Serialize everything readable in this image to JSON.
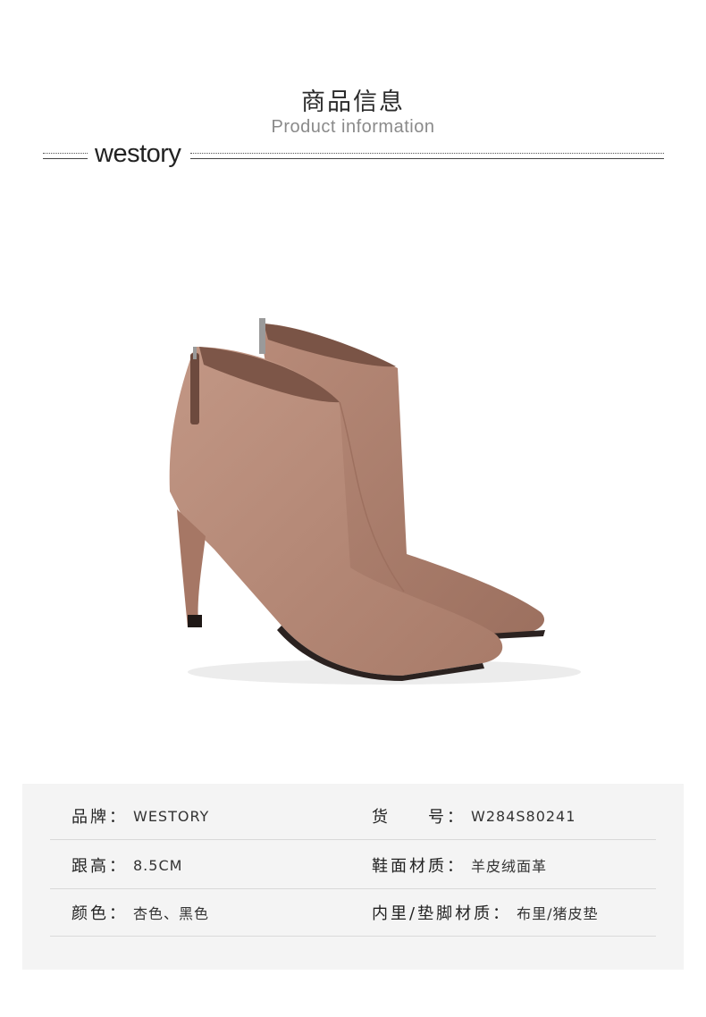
{
  "header": {
    "title_cn": "商品信息",
    "title_en": "Product information",
    "brand_logo": "westory"
  },
  "product_image": {
    "subject": "boots-icon",
    "color": "#b58a78"
  },
  "info": {
    "rows": [
      {
        "left": {
          "label": "品牌：",
          "value": "WESTORY"
        },
        "right": {
          "label": "货　　号：",
          "value": "W284S80241"
        }
      },
      {
        "left": {
          "label": "跟高：",
          "value": "8.5CM"
        },
        "right": {
          "label": "鞋面材质：",
          "value": "羊皮绒面革"
        }
      },
      {
        "left": {
          "label": "颜色：",
          "value": "杏色、黑色"
        },
        "right": {
          "label": "内里/垫脚材质：",
          "value": "布里/猪皮垫"
        }
      }
    ]
  }
}
